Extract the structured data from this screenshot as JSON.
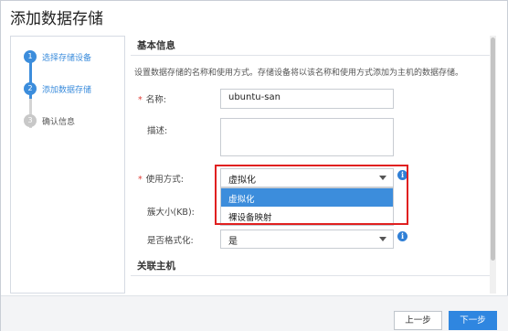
{
  "dialog": {
    "title": "添加数据存储"
  },
  "steps": [
    {
      "num": "1",
      "label": "选择存储设备"
    },
    {
      "num": "2",
      "label": "添加数据存储"
    },
    {
      "num": "3",
      "label": "确认信息"
    }
  ],
  "form": {
    "section_basic": "基本信息",
    "description": "设置数据存储的名称和使用方式。存储设备将以该名称和使用方式添加为主机的数据存储。",
    "name_label": "名称:",
    "name_value": "ubuntu-san",
    "desc_label": "描述:",
    "usage_label": "使用方式:",
    "usage_value": "虚拟化",
    "usage_options": [
      "虚拟化",
      "裸设备映射"
    ],
    "cluster_label": "簇大小(KB):",
    "format_label": "是否格式化:",
    "format_value": "是",
    "section_hosts": "关联主机",
    "required_mark": "*",
    "info_icon": "i"
  },
  "footer": {
    "prev_label": "上一步",
    "next_label": "下一步"
  },
  "colors": {
    "accent": "#3c8ddc",
    "highlight": "#e02020"
  }
}
